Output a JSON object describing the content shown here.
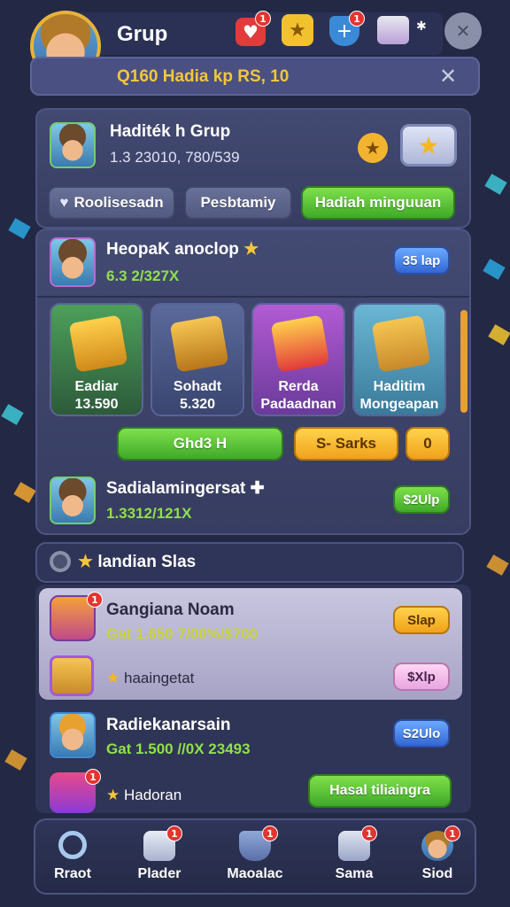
{
  "header": {
    "title": "Grup",
    "info_text": "Q160 Hadia kp RS, 10",
    "icons": [
      "heart-icon",
      "star-icon",
      "shield-plus-icon",
      "mailbox-icon",
      "chat-icon"
    ]
  },
  "group_card": {
    "name": "Haditék h Grup",
    "stats": "1.3 23010, 780/539",
    "tabs": [
      "Roolisesadn",
      "Pesbtamiy",
      "Hadiah minguuan"
    ]
  },
  "member_1": {
    "name": "HeopaK anoclop",
    "score": "6.3 2/327X",
    "level_button": "35 lap"
  },
  "reward_tiles": [
    {
      "line1": "Eadiar",
      "line2": "13.590"
    },
    {
      "line1": "Sohadt",
      "line2": "5.320"
    },
    {
      "line1": "Rerda",
      "line2": "Padaadnan"
    },
    {
      "line1": "Haditim",
      "line2": "Mongeapan"
    }
  ],
  "actions": {
    "claim_label": "Ghd3 H",
    "sort_label": "S- Sarks",
    "count_label": "0"
  },
  "member_2": {
    "name": "Sadialamingersat",
    "score": "1.3312/121X",
    "level_button": "$2Ulp"
  },
  "section": {
    "title": "landian Slas"
  },
  "list": [
    {
      "name": "Gangiana Noam",
      "score": "Gat 1.650 7/00%/$700",
      "button": "Slap"
    },
    {
      "name": "haaingetat",
      "score": "",
      "button": "$Xlp"
    },
    {
      "name": "Radiekanarsain",
      "score": "Gat 1.500 //0X 23493",
      "button": "S2Ulo"
    },
    {
      "name": "Hadoran",
      "score": "",
      "button": "Hasal tiliaingra"
    }
  ],
  "bottom_nav": [
    {
      "label": "Rraot",
      "icon": "search-icon"
    },
    {
      "label": "Plader",
      "icon": "mail-icon"
    },
    {
      "label": "Maoalac",
      "icon": "shield-icon"
    },
    {
      "label": "Sama",
      "icon": "chat-icon"
    },
    {
      "label": "Siod",
      "icon": "profile-icon"
    }
  ],
  "badges": {
    "notif": "1"
  }
}
